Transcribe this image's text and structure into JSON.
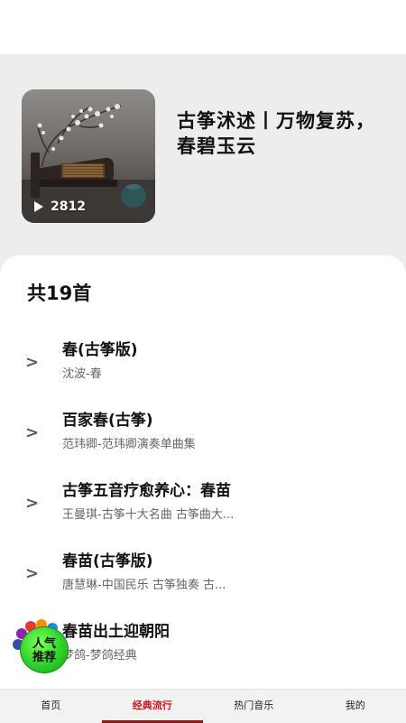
{
  "album": {
    "title": "古筝沭述丨万物复苏，春碧玉云",
    "play_count": "2812"
  },
  "list": {
    "count_label": "共19首",
    "songs": [
      {
        "name": "春(古筝版)",
        "artist": "沈波-春"
      },
      {
        "name": "百家春(古筝)",
        "artist": "范玮卿-范玮卿演奏单曲集"
      },
      {
        "name": "古筝五音疗愈养心：春苗",
        "artist": "王曼琪-古筝十大名曲 古筝曲大..."
      },
      {
        "name": "春苗(古筝版)",
        "artist": "唐慧琳-中国民乐 古筝独奏 古..."
      },
      {
        "name": "春苗出土迎朝阳",
        "artist": "梦鸽-梦鸽经典"
      }
    ],
    "arrow": ">"
  },
  "badge": {
    "line1": "人气",
    "line2": "推荐"
  },
  "tabs": [
    {
      "label": "首页"
    },
    {
      "label": "经典流行"
    },
    {
      "label": "热门音乐"
    },
    {
      "label": "我的"
    }
  ],
  "colors": {
    "active_tab": "#c8161d",
    "badge_green": "#2ed12a"
  }
}
